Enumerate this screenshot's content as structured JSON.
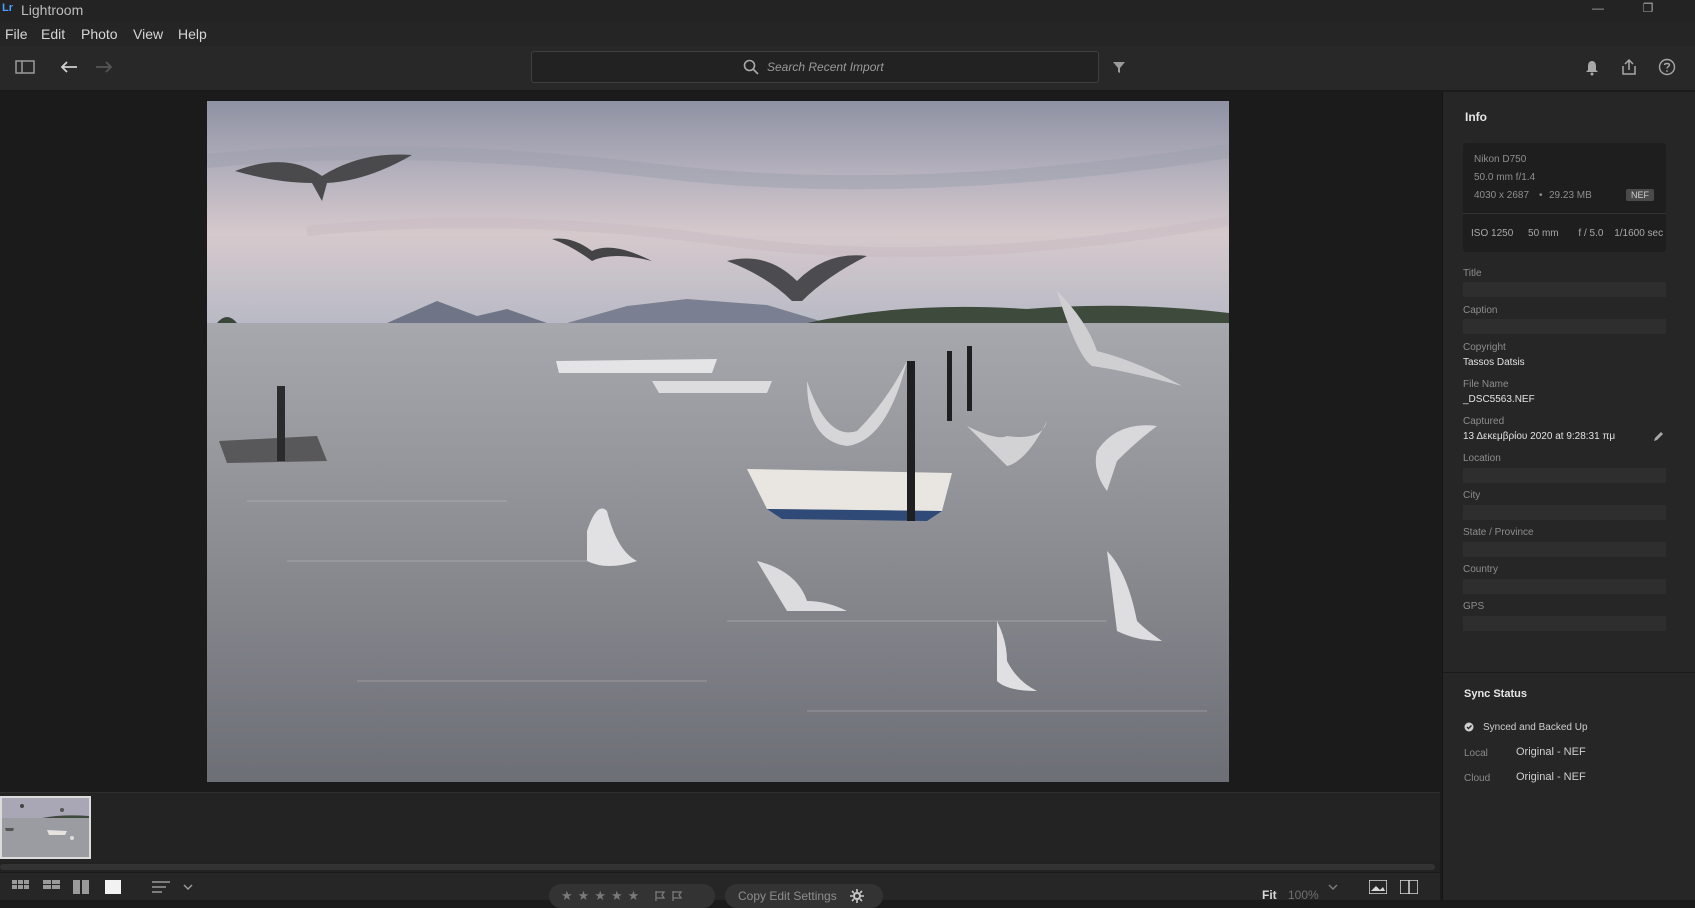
{
  "app": {
    "logo": "Lr",
    "title": "Lightroom"
  },
  "window_controls": {
    "minimize": "—",
    "restore": "❐"
  },
  "menu": [
    "File",
    "Edit",
    "Photo",
    "View",
    "Help"
  ],
  "search": {
    "placeholder": "Search Recent Import"
  },
  "info_panel": {
    "title": "Info",
    "camera": "Nikon D750",
    "lens": "50.0 mm f/1.4",
    "dimensions": "4030 x 2687",
    "filesize": "29.23 MB",
    "dot": "•",
    "format": "NEF",
    "iso": "ISO 1250",
    "focal": "50 mm",
    "aperture": "f / 5.0",
    "shutter": "1/1600 sec",
    "fields": {
      "title_label": "Title",
      "caption_label": "Caption",
      "copyright_label": "Copyright",
      "copyright_value": "Tassos Datsis",
      "filename_label": "File Name",
      "filename_value": "_DSC5563.NEF",
      "captured_label": "Captured",
      "captured_value": "13 Δεκεμβρίου 2020 at 9:28:31 πμ",
      "location_label": "Location",
      "city_label": "City",
      "state_label": "State / Province",
      "country_label": "Country",
      "gps_label": "GPS"
    }
  },
  "sync": {
    "title": "Sync Status",
    "status": "Synced and Backed Up",
    "local_label": "Local",
    "local_value": "Original - NEF",
    "cloud_label": "Cloud",
    "cloud_value": "Original - NEF"
  },
  "bottom": {
    "stars": [
      "★",
      "★",
      "★",
      "★",
      "★"
    ],
    "copy_edit": "Copy Edit Settings",
    "zoom_fit": "Fit",
    "zoom_pct": "100%"
  },
  "colors": {
    "accent": "#4a9eff",
    "panel_bg": "#262626",
    "canvas_bg": "#1b1b1b"
  }
}
